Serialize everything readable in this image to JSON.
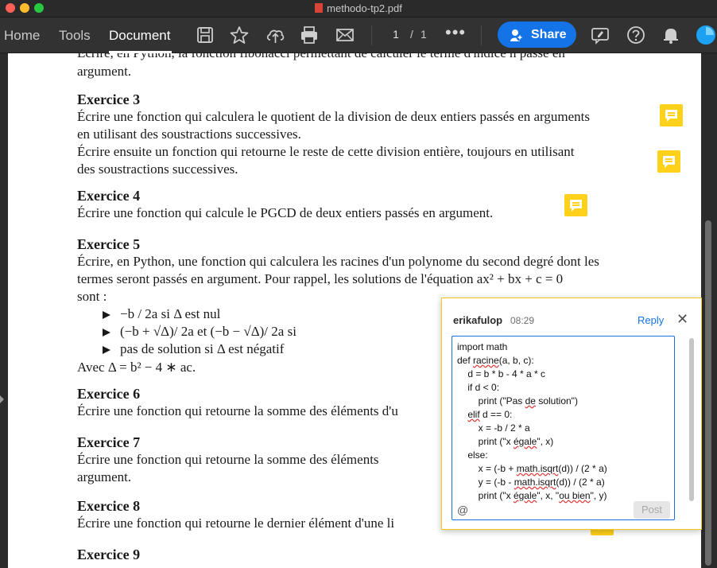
{
  "window": {
    "title": "methodo-tp2.pdf"
  },
  "toolbar": {
    "tabs": [
      {
        "label": "Home"
      },
      {
        "label": "Tools"
      },
      {
        "label": "Document"
      }
    ],
    "page_current": "1",
    "page_separator": "/",
    "page_total": "1",
    "more": "•••",
    "share_label": "Share"
  },
  "document": {
    "lines": {
      "top1": "Écrire, en Python, la fonction fibonacci permettant de calculer le terme d'indice n passé en",
      "top2": "argument.",
      "ex3_title": "Exercice 3",
      "ex3_l1": "Écrire une fonction qui calculera le quotient de la division de deux entiers passés en arguments",
      "ex3_l2": "en utilisant des soustractions successives.",
      "ex3_l3": "Écrire ensuite un fonction qui retourne le reste de cette division entière, toujours en utilisant",
      "ex3_l4": "des soustractions successives.",
      "ex4_title": "Exercice 4",
      "ex4_l1": "Écrire une fonction qui calcule le PGCD de deux entiers passés en argument.",
      "ex5_title": "Exercice 5",
      "ex5_l1": "Écrire, en Python, une fonction qui calculera les racines d'un polynome du second degré dont les",
      "ex5_l2": "termes seront passés en argument. Pour rappel, les solutions de l'équation ax² + bx + c = 0",
      "ex5_l3": "sont :",
      "ex5_b1": "−b / 2a si Δ est nul",
      "ex5_b2": "(−b + √Δ)/ 2a et (−b − √Δ)/ 2a si",
      "ex5_b3": "pas de solution si Δ est négatif",
      "ex5_l4": "Avec Δ = b² − 4 ∗ ac.",
      "ex6_title": "Exercice 6",
      "ex6_l1": "Écrire une fonction qui retourne la somme des éléments d'u",
      "ex7_title": "Exercice 7",
      "ex7_l1": "Écrire une fonction qui retourne la somme des éléments",
      "ex7_l2": "argument.",
      "ex8_title": "Exercice 8",
      "ex8_l1": "Écrire une fonction qui retourne le dernier élément d'une li",
      "ex9_title": "Exercice 9"
    }
  },
  "comment": {
    "user": "erikafulop",
    "time": "08:29",
    "reply_label": "Reply",
    "close_glyph": "✕",
    "at_glyph": "@",
    "post_label": "Post",
    "code": {
      "c1": "import math",
      "c2a": "def ",
      "c2b": "racine",
      "c2c": "(a, b, c):",
      "c3": "    d = b * b - 4 * a * c",
      "c4": "    if d < 0:",
      "c5a": "        print (\"Pas ",
      "c5b": "de",
      "c5c": " solution\")",
      "c6a": "    ",
      "c6b": "elif",
      "c6c": " d == 0:",
      "c7": "        x = -b / 2 * a",
      "c8a": "        print (\"x ",
      "c8b": "égale",
      "c8c": "\", x)",
      "c9": "    else:",
      "c10a": "        x = (-b + ",
      "c10b": "math.isqrt",
      "c10c": "(d)) / (2 * a)",
      "c11a": "        y = (-b - ",
      "c11b": "math.isqrt",
      "c11c": "(d)) / (2 * a)",
      "c12a": "        print (\"x ",
      "c12b": "égale",
      "c12c": "\", x, \"",
      "c12d": "ou bien",
      "c12e": "\", y)"
    }
  },
  "colors": {
    "accent": "#1473e6",
    "note": "#ffd11a",
    "popup_border": "#f5c518"
  }
}
